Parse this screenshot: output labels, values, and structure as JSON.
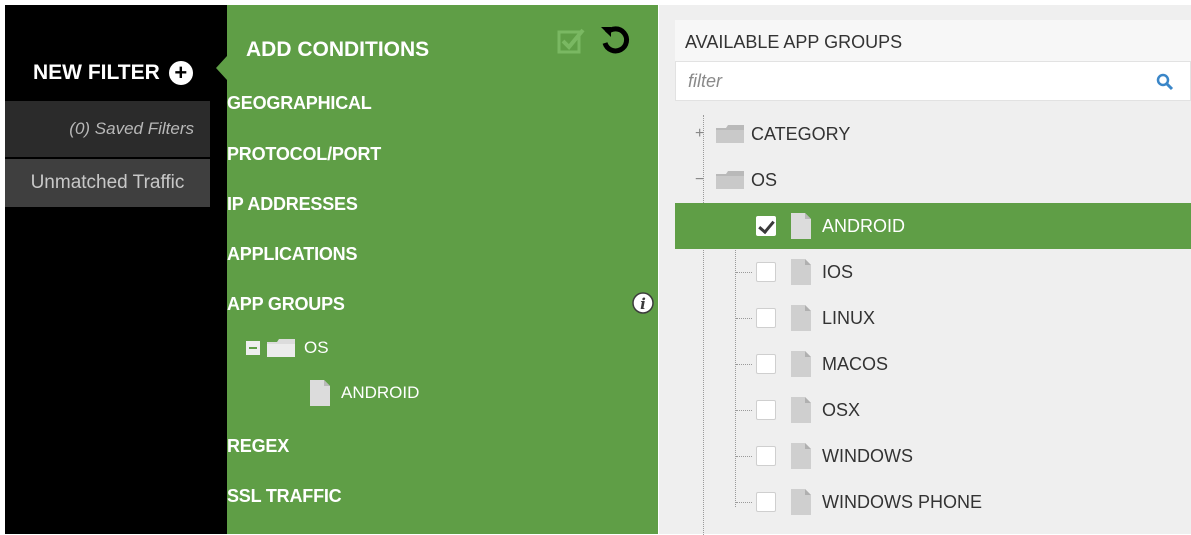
{
  "sidebar": {
    "new_filter_label": "NEW FILTER",
    "saved_filters_label": "(0) Saved Filters",
    "unmatched_label": "Unmatched Traffic"
  },
  "conditions": {
    "title": "ADD CONDITIONS",
    "items": [
      {
        "label": "GEOGRAPHICAL"
      },
      {
        "label": "PROTOCOL/PORT"
      },
      {
        "label": "IP ADDRESSES"
      },
      {
        "label": "APPLICATIONS"
      },
      {
        "label": "APP GROUPS"
      },
      {
        "label": "REGEX"
      },
      {
        "label": "SSL TRAFFIC"
      }
    ],
    "app_groups_tree": {
      "folder_label": "OS",
      "child_label": "ANDROID"
    }
  },
  "available": {
    "header": "AVAILABLE APP GROUPS",
    "filter_placeholder": "filter",
    "category_label": "CATEGORY",
    "os_label": "OS",
    "items": [
      {
        "label": "ANDROID",
        "checked": true
      },
      {
        "label": "IOS",
        "checked": false
      },
      {
        "label": "LINUX",
        "checked": false
      },
      {
        "label": "MACOS",
        "checked": false
      },
      {
        "label": "OSX",
        "checked": false
      },
      {
        "label": "WINDOWS",
        "checked": false
      },
      {
        "label": "WINDOWS PHONE",
        "checked": false
      }
    ]
  },
  "colors": {
    "accent_green": "#5f9e46",
    "sidebar_black": "#000000"
  }
}
